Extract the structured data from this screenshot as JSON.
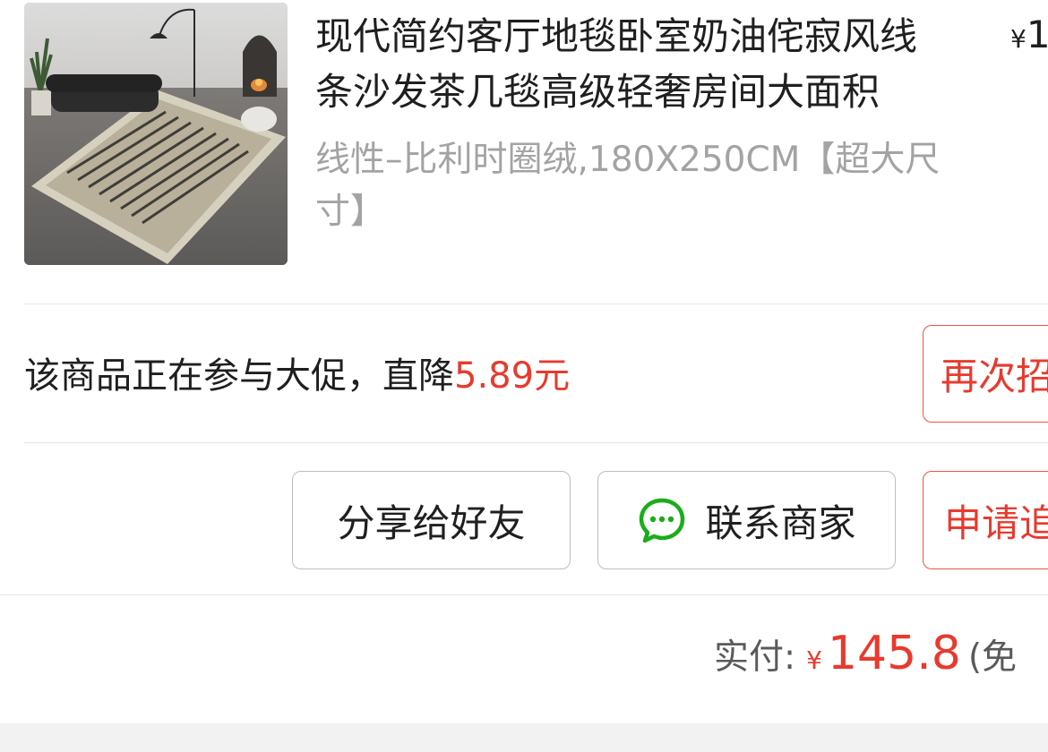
{
  "product": {
    "title": "现代简约客厅地毯卧室奶油侘寂风线条沙发茶几毯高级轻奢房间大面积",
    "spec": "线性–比利时圈绒,180X250CM【超大尺寸】",
    "unit_price_symbol": "¥",
    "unit_price_visible": "1"
  },
  "promo": {
    "text": "该商品正在参与大促，直降",
    "amount": "5.89元"
  },
  "buttons": {
    "rebuy_label": "再次招",
    "share_label": "分享给好友",
    "contact_label": "联系商家",
    "contact_icon": "wechat-chat-icon",
    "apply_label": "申请追"
  },
  "payment": {
    "label": "实付:",
    "currency": "¥",
    "amount": "145.8",
    "note": "(免"
  },
  "colors": {
    "accent_red": "#e83a2e",
    "wechat_green": "#1aad19",
    "text_gray": "#a3a3a3"
  }
}
